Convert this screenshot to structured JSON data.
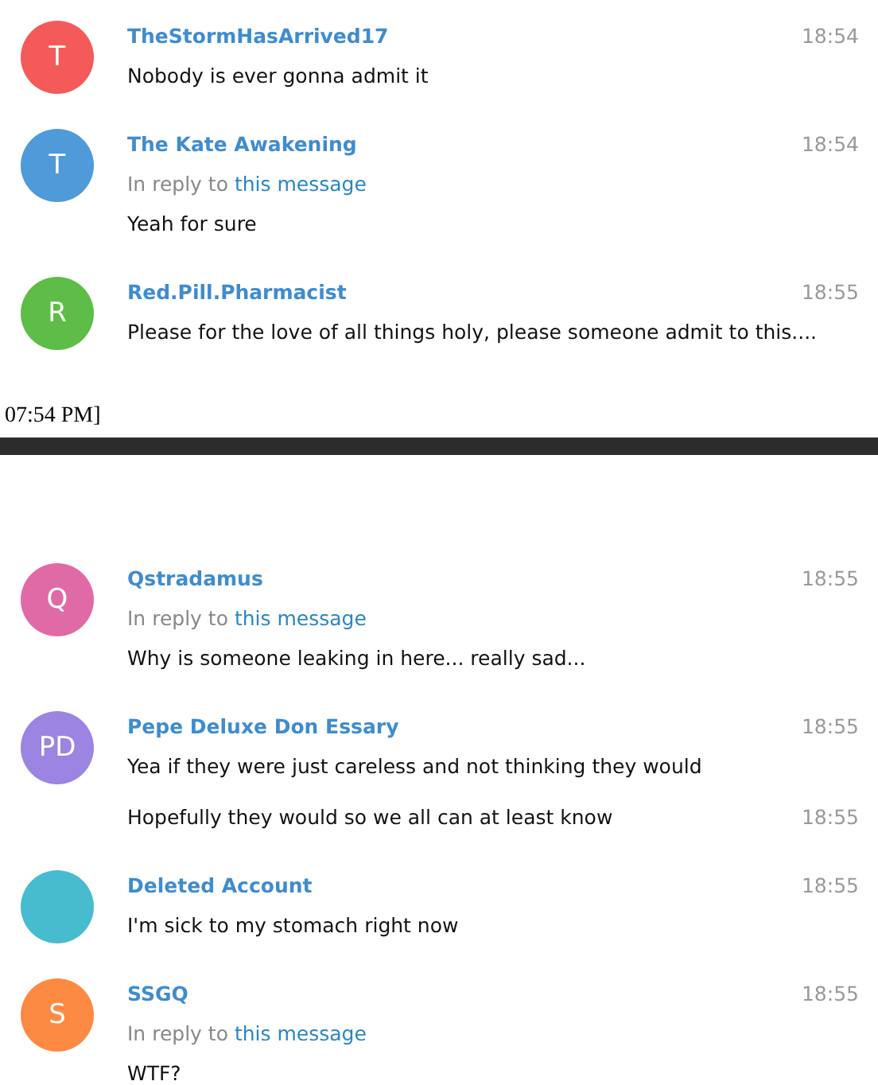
{
  "panels": [
    {
      "messages": [
        {
          "avatar": {
            "initials": "T",
            "color": "#f55a5a"
          },
          "name": "TheStormHasArrived17",
          "time": "18:54",
          "text": "Nobody is ever gonna admit it"
        },
        {
          "avatar": {
            "initials": "T",
            "color": "#4f9ad8"
          },
          "name": "The Kate Awakening",
          "time": "18:54",
          "reply": {
            "prefix": "In reply to",
            "link": "this message"
          },
          "text": "Yeah for sure"
        },
        {
          "avatar": {
            "initials": "R",
            "color": "#5dbd47"
          },
          "name": "Red.Pill.Pharmacist",
          "time": "18:55",
          "text": "Please for the love of all things holy, please someone admit to this...."
        }
      ]
    },
    {
      "messages": [
        {
          "avatar": {
            "initials": "Q",
            "color": "#e06aa6"
          },
          "name": "Qstradamus",
          "time": "18:55",
          "reply": {
            "prefix": "In reply to",
            "link": "this message"
          },
          "text": "Why is someone leaking in here... really sad..."
        },
        {
          "avatar": {
            "initials": "PD",
            "color": "#9b84e2"
          },
          "name": "Pepe Deluxe Don Essary",
          "time": "18:55",
          "text": "Yea if they were just careless and not thinking they would",
          "followups": [
            {
              "text": "Hopefully they would so we all can at least know",
              "time": "18:55"
            }
          ]
        },
        {
          "avatar": {
            "color": "#48bccf"
          },
          "name": "Deleted Account",
          "time": "18:55",
          "text": "I'm sick to my stomach right now"
        },
        {
          "avatar": {
            "initials": "S",
            "color": "#fd8a42"
          },
          "name": "SSGQ",
          "time": "18:55",
          "reply": {
            "prefix": "In reply to",
            "link": "this message"
          },
          "text": "WTF?"
        }
      ]
    }
  ],
  "separator": {
    "caption": "07:54 PM]"
  }
}
